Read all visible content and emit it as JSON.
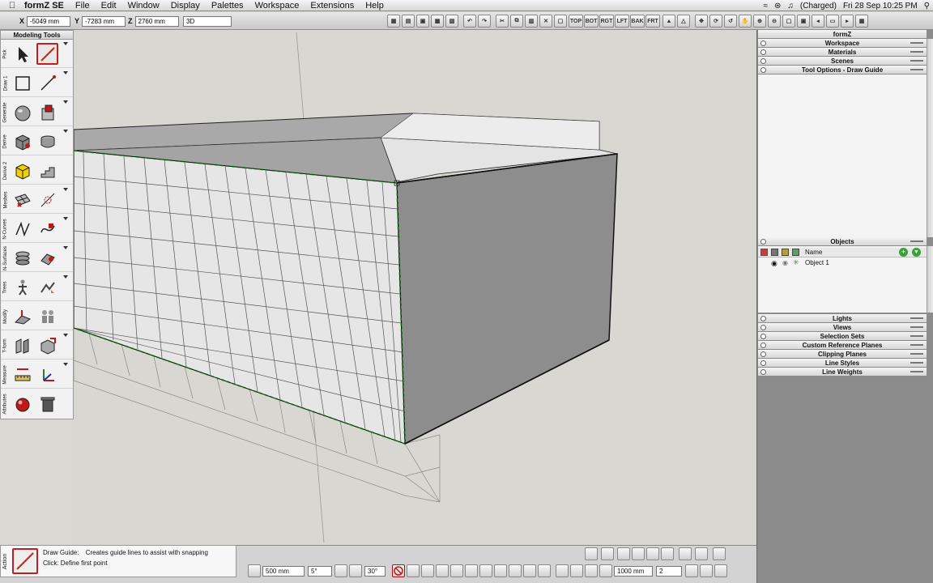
{
  "menubar": {
    "app_name": "formZ SE",
    "items": [
      "File",
      "Edit",
      "Window",
      "Display",
      "Palettes",
      "Workspace",
      "Extensions",
      "Help"
    ],
    "battery": "(Charged)",
    "datetime": "Fri 28 Sep  10:25 PM"
  },
  "coords": {
    "x_label": "X",
    "x_value": "-5049 mm",
    "y_label": "Y",
    "y_value": "-7283 mm",
    "z_label": "Z",
    "z_value": "2760 mm",
    "mode": "3D"
  },
  "view_buttons": [
    "TOP",
    "BOT",
    "RGT",
    "LFT",
    "BAK",
    "FRT"
  ],
  "tools_palette": {
    "title": "Modeling Tools",
    "groups": [
      "Pick",
      "Draw 1",
      "Generate",
      "Derive",
      "Derive 2",
      "Meshes",
      "N-Curves",
      "N-Surfaces",
      "Trees",
      "Modify",
      "T-form",
      "Measure",
      "Attributes"
    ]
  },
  "right_panel": {
    "title": "formZ",
    "top_sections": [
      "Workspace",
      "Materials",
      "Scenes",
      "Tool Options - Draw Guide"
    ],
    "objects_header": "Objects",
    "objects_column": "Name",
    "objects": [
      "Object 1"
    ],
    "bottom_sections": [
      "Lights",
      "Views",
      "Selection Sets",
      "Custom Reference Planes",
      "Clipping Planes",
      "Line Styles",
      "Line Weights"
    ]
  },
  "prompt": {
    "tool_name": "Draw Guide:",
    "description": "Creates guide lines to assist with snapping",
    "instruction": "Click: Define first point",
    "side_label": "Action"
  },
  "bottom_toolbar": {
    "grid": "500 mm",
    "angle": "5°",
    "angle2": "30°",
    "distance": "1000 mm",
    "count": "2"
  }
}
